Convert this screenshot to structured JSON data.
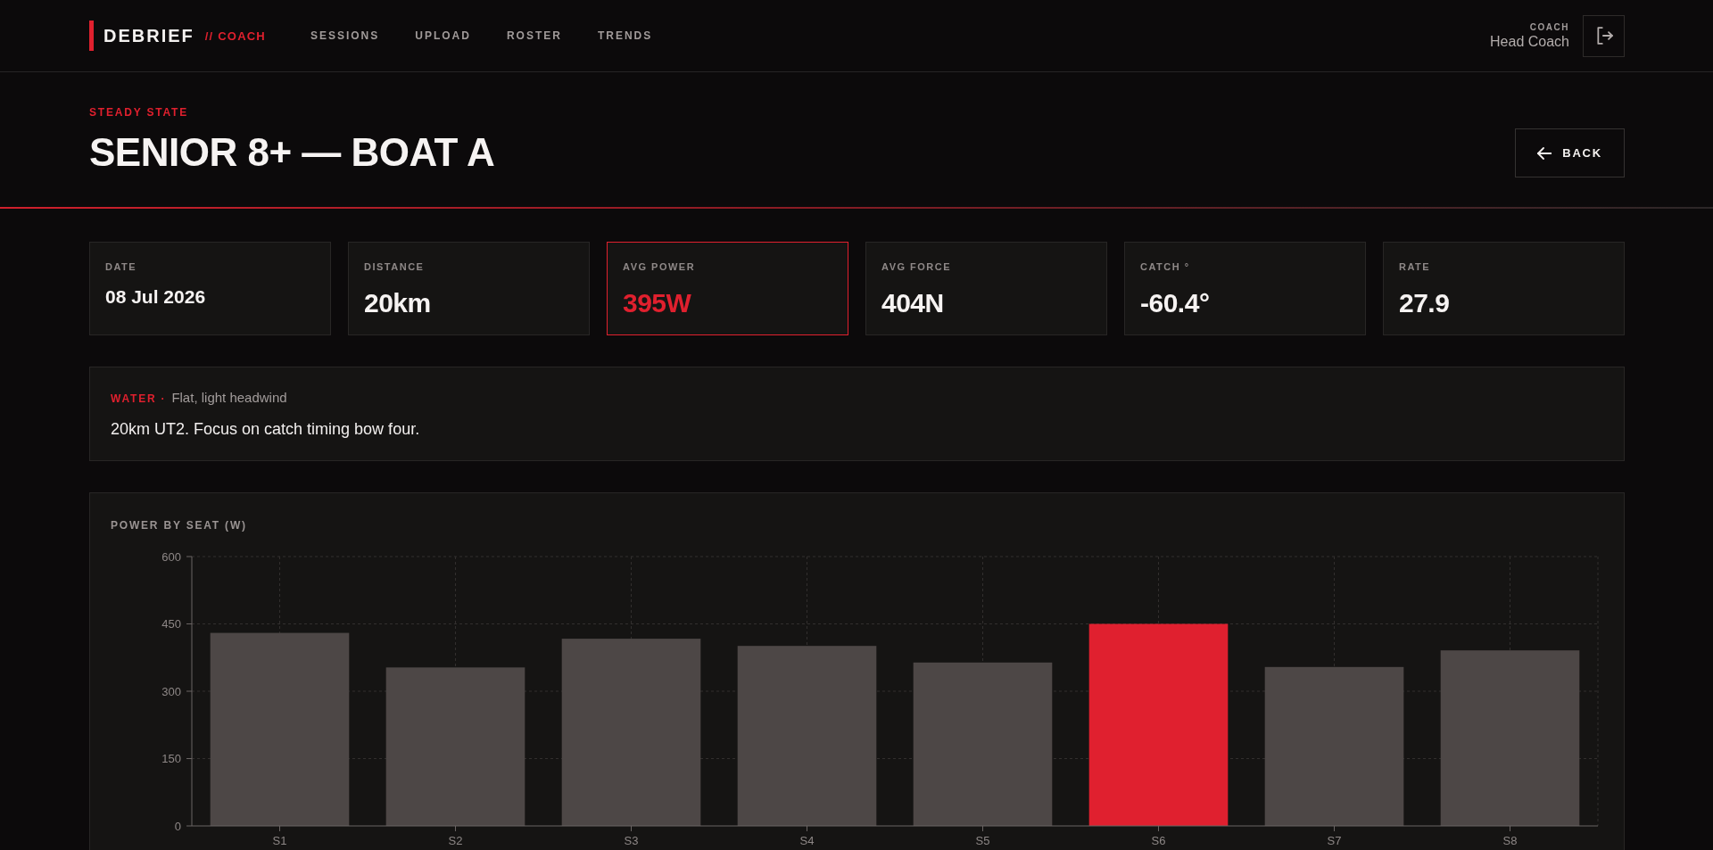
{
  "header": {
    "brand": "DEBRIEF",
    "brand_suffix": "// COACH",
    "nav": [
      "SESSIONS",
      "UPLOAD",
      "ROSTER",
      "TRENDS"
    ],
    "user": {
      "role": "COACH",
      "name": "Head Coach"
    }
  },
  "hero": {
    "eyebrow": "STEADY STATE",
    "title": "SENIOR 8+ — BOAT A",
    "back_button": "BACK"
  },
  "stats": [
    {
      "kind": "date",
      "label": "DATE",
      "value": "08 Jul 2026",
      "highlighted": false
    },
    {
      "kind": "metric",
      "label": "DISTANCE",
      "value": "20km",
      "highlighted": false
    },
    {
      "kind": "metric",
      "label": "AVG POWER",
      "value": "395W",
      "highlighted": true
    },
    {
      "kind": "metric",
      "label": "AVG FORCE",
      "value": "404N",
      "highlighted": false
    },
    {
      "kind": "metric",
      "label": "CATCH °",
      "value": "-60.4°",
      "highlighted": false
    },
    {
      "kind": "metric",
      "label": "RATE",
      "value": "27.9",
      "highlighted": false
    }
  ],
  "notes": {
    "label": "WATER ·",
    "conditions": "Flat, light headwind",
    "text": "20km UT2. Focus on catch timing bow four."
  },
  "power_chart": {
    "chart_data": {
      "type": "bar",
      "title": "POWER BY SEAT (W)",
      "categories": [
        "S1",
        "S2",
        "S3",
        "S4",
        "S5",
        "S6",
        "S7",
        "S8"
      ],
      "series": [
        {
          "color": "#4d4746",
          "values": [
            430,
            353,
            417,
            401,
            364,
            null,
            354,
            391
          ]
        },
        {
          "color": "#e0202f",
          "values": [
            null,
            null,
            null,
            null,
            null,
            450,
            null,
            null
          ]
        }
      ],
      "stacked": true,
      "ylim": [
        0,
        600
      ],
      "yticks": [
        0,
        150,
        300,
        450,
        600
      ],
      "grid": true
    }
  }
}
